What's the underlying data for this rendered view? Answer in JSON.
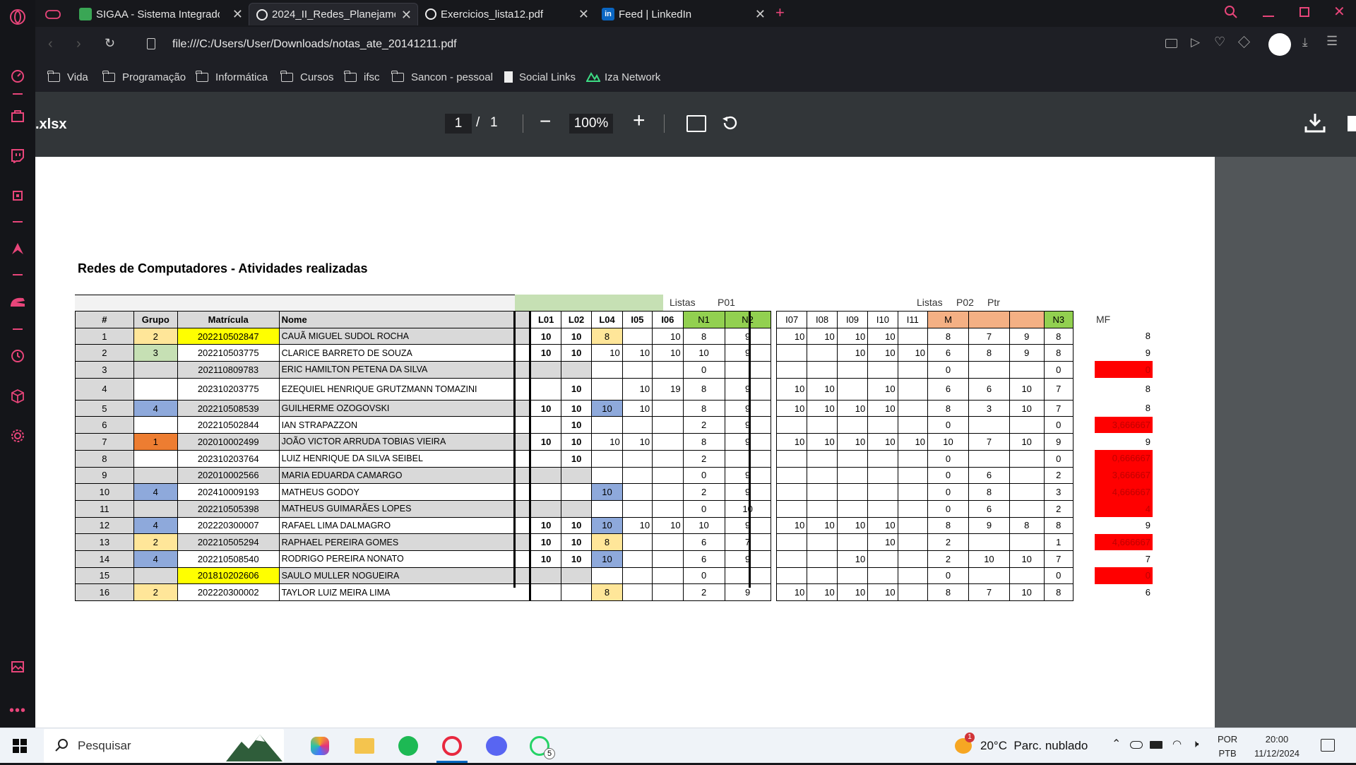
{
  "sidebar": {
    "icons": [
      "opera-logo-icon",
      "speed-dial-icon",
      "bag-icon",
      "twitch-icon",
      "chip-icon",
      "arrow-icon",
      "helmet-icon",
      "history-icon",
      "cube-icon",
      "settings-icon",
      "gallery-icon",
      "more-icon"
    ]
  },
  "tabs": [
    {
      "label": "SIGAA - Sistema Integrado",
      "favicon_color": "#3aa655"
    },
    {
      "label": "2024_II_Redes_Planejament",
      "favicon_color": "#ffffff",
      "active": true
    },
    {
      "label": "Exercicios_lista12.pdf",
      "favicon_color": "#ffffff"
    },
    {
      "label": "Feed | LinkedIn",
      "favicon_color": "#0a66c2"
    }
  ],
  "address": {
    "url": "file:///C:/Users/User/Downloads/notas_ate_20141211.pdf"
  },
  "bookmarks": [
    "Vida",
    "Programação",
    "Informática",
    "Cursos",
    "ifsc",
    "Sancon - pessoal",
    "Social Links",
    "Iza Network"
  ],
  "pdf_toolbar": {
    "filename": ".xlsx",
    "page_current": "1",
    "page_sep": "/",
    "page_total": "1",
    "zoom": "100%",
    "minus": "−",
    "plus": "+"
  },
  "sheet": {
    "title": "Redes de Computadores - Atividades realizadas",
    "group_headers": {
      "listas1": "Listas",
      "p01": "P01",
      "listas2": "Listas",
      "p02": "P02",
      "ptr": "Ptr",
      "mf": "MF"
    },
    "columns": [
      "#",
      "Grupo",
      "Matrícula",
      "Nome",
      "L01",
      "L02",
      "L04",
      "I05",
      "I06",
      "N1",
      "N2",
      "I07",
      "I08",
      "I09",
      "I10",
      "I11",
      "M",
      "",
      "",
      "N3"
    ],
    "rows": [
      {
        "n": "1",
        "grupo": "2",
        "gc": "yel",
        "mat": "202210502847",
        "mc": "bright",
        "nome": "CAUÃ MIGUEL SUDOL ROCHA",
        "l01": "10",
        "l02": "10",
        "l04": "8",
        "l4c": "yel",
        "i05": "",
        "i06": "10",
        "n1": "8",
        "n2": "9",
        "i07": "10",
        "i08": "10",
        "i09": "10",
        "i10": "10",
        "i11": "",
        "m": "8",
        "p02": "7",
        "ptr": "9",
        "n3": "8",
        "mf": "8",
        "mfc": ""
      },
      {
        "n": "2",
        "grupo": "3",
        "gc": "grn",
        "mat": "202210503775",
        "mc": "",
        "nome": "CLARICE BARRETO DE SOUZA",
        "l01": "10",
        "l02": "10",
        "l04": "10",
        "l4c": "",
        "i05": "10",
        "i06": "10",
        "n1": "10",
        "n2": "9",
        "i07": "",
        "i08": "",
        "i09": "10",
        "i10": "10",
        "i11": "10",
        "m": "6",
        "p02": "8",
        "ptr": "9",
        "n3": "8",
        "mf": "9",
        "mfc": ""
      },
      {
        "n": "3",
        "grupo": "",
        "gc": "",
        "mat": "202110809783",
        "mc": "",
        "nome": "ERIC HAMILTON PETENA DA SILVA",
        "l01": "",
        "l02": "",
        "l04": "",
        "l4c": "",
        "i05": "",
        "i06": "",
        "n1": "0",
        "n2": "",
        "i07": "",
        "i08": "",
        "i09": "",
        "i10": "",
        "i11": "",
        "m": "0",
        "p02": "",
        "ptr": "",
        "n3": "0",
        "mf": "0",
        "mfc": "red"
      },
      {
        "n": "4",
        "grupo": "",
        "gc": "",
        "mat": "202310203775",
        "mc": "",
        "nome": "EZEQUIEL HENRIQUE GRUTZMANN TOMAZINI",
        "l01": "",
        "l02": "10",
        "l04": "",
        "l4c": "",
        "i05": "10",
        "i06": "19",
        "n1": "8",
        "n2": "9",
        "i07": "10",
        "i08": "10",
        "i09": "",
        "i10": "10",
        "i11": "",
        "m": "6",
        "p02": "6",
        "ptr": "10",
        "n3": "7",
        "mf": "8",
        "mfc": ""
      },
      {
        "n": "5",
        "grupo": "4",
        "gc": "blu",
        "mat": "202210508539",
        "mc": "",
        "nome": "GUILHERME OZOGOVSKI",
        "l01": "10",
        "l02": "10",
        "l04": "10",
        "l4c": "blu",
        "i05": "10",
        "i06": "",
        "n1": "8",
        "n2": "9",
        "i07": "10",
        "i08": "10",
        "i09": "10",
        "i10": "10",
        "i11": "",
        "m": "8",
        "p02": "3",
        "ptr": "10",
        "n3": "7",
        "mf": "8",
        "mfc": ""
      },
      {
        "n": "6",
        "grupo": "",
        "gc": "",
        "mat": "202210502844",
        "mc": "",
        "nome": "IAN STRAPAZZON",
        "l01": "",
        "l02": "10",
        "l04": "",
        "l4c": "",
        "i05": "",
        "i06": "",
        "n1": "2",
        "n2": "9",
        "i07": "",
        "i08": "",
        "i09": "",
        "i10": "",
        "i11": "",
        "m": "0",
        "p02": "",
        "ptr": "",
        "n3": "0",
        "mf": "3,666667",
        "mfc": "red"
      },
      {
        "n": "7",
        "grupo": "1",
        "gc": "org",
        "mat": "202010002499",
        "mc": "",
        "nome": "JOÃO VICTOR ARRUDA TOBIAS VIEIRA",
        "l01": "10",
        "l02": "10",
        "l04": "10",
        "l4c": "",
        "i05": "10",
        "i06": "",
        "n1": "8",
        "n2": "9",
        "i07": "10",
        "i08": "10",
        "i09": "10",
        "i10": "10",
        "i11": "10",
        "m": "10",
        "p02": "7",
        "ptr": "10",
        "n3": "9",
        "mf": "9",
        "mfc": ""
      },
      {
        "n": "8",
        "grupo": "",
        "gc": "",
        "mat": "202310203764",
        "mc": "",
        "nome": "LUIZ HENRIQUE DA SILVA SEIBEL",
        "l01": "",
        "l02": "10",
        "l04": "",
        "l4c": "",
        "i05": "",
        "i06": "",
        "n1": "2",
        "n2": "",
        "i07": "",
        "i08": "",
        "i09": "",
        "i10": "",
        "i11": "",
        "m": "0",
        "p02": "",
        "ptr": "",
        "n3": "0",
        "mf": "0,666667",
        "mfc": "red"
      },
      {
        "n": "9",
        "grupo": "",
        "gc": "",
        "mat": "202010002566",
        "mc": "",
        "nome": "MARIA EDUARDA CAMARGO",
        "l01": "",
        "l02": "",
        "l04": "",
        "l4c": "",
        "i05": "",
        "i06": "",
        "n1": "0",
        "n2": "9",
        "i07": "",
        "i08": "",
        "i09": "",
        "i10": "",
        "i11": "",
        "m": "0",
        "p02": "6",
        "ptr": "",
        "n3": "2",
        "mf": "3,666667",
        "mfc": "red"
      },
      {
        "n": "10",
        "grupo": "4",
        "gc": "blu",
        "mat": "202410009193",
        "mc": "",
        "nome": "MATHEUS GODOY",
        "l01": "",
        "l02": "",
        "l04": "10",
        "l4c": "blu",
        "i05": "",
        "i06": "",
        "n1": "2",
        "n2": "9",
        "i07": "",
        "i08": "",
        "i09": "",
        "i10": "",
        "i11": "",
        "m": "0",
        "p02": "8",
        "ptr": "",
        "n3": "3",
        "mf": "4,666667",
        "mfc": "red"
      },
      {
        "n": "11",
        "grupo": "",
        "gc": "",
        "mat": "202210505398",
        "mc": "",
        "nome": "MATHEUS GUIMARÃES LOPES",
        "l01": "",
        "l02": "",
        "l04": "",
        "l4c": "",
        "i05": "",
        "i06": "",
        "n1": "0",
        "n2": "10",
        "i07": "",
        "i08": "",
        "i09": "",
        "i10": "",
        "i11": "",
        "m": "0",
        "p02": "6",
        "ptr": "",
        "n3": "2",
        "mf": "4",
        "mfc": "red"
      },
      {
        "n": "12",
        "grupo": "4",
        "gc": "blu",
        "mat": "202220300007",
        "mc": "",
        "nome": "RAFAEL LIMA DALMAGRO",
        "l01": "10",
        "l02": "10",
        "l04": "10",
        "l4c": "blu",
        "i05": "10",
        "i06": "10",
        "n1": "10",
        "n2": "9",
        "i07": "10",
        "i08": "10",
        "i09": "10",
        "i10": "10",
        "i11": "",
        "m": "8",
        "p02": "9",
        "ptr": "8",
        "n3": "8",
        "mf": "9",
        "mfc": ""
      },
      {
        "n": "13",
        "grupo": "2",
        "gc": "yel",
        "mat": "202210505294",
        "mc": "",
        "nome": "RAPHAEL PEREIRA GOMES",
        "l01": "10",
        "l02": "10",
        "l04": "8",
        "l4c": "yel",
        "i05": "",
        "i06": "",
        "n1": "6",
        "n2": "7",
        "i07": "",
        "i08": "",
        "i09": "",
        "i10": "10",
        "i11": "",
        "m": "2",
        "p02": "",
        "ptr": "",
        "n3": "1",
        "mf": "4,666667",
        "mfc": "red"
      },
      {
        "n": "14",
        "grupo": "4",
        "gc": "blu",
        "mat": "202210508540",
        "mc": "",
        "nome": "RODRIGO PEREIRA NONATO",
        "l01": "10",
        "l02": "10",
        "l04": "10",
        "l4c": "blu",
        "i05": "",
        "i06": "",
        "n1": "6",
        "n2": "9",
        "i07": "",
        "i08": "",
        "i09": "10",
        "i10": "",
        "i11": "",
        "m": "2",
        "p02": "10",
        "ptr": "10",
        "n3": "7",
        "mf": "7",
        "mfc": ""
      },
      {
        "n": "15",
        "grupo": "",
        "gc": "",
        "mat": "201810202606",
        "mc": "bright",
        "nome": "SAULO MULLER NOGUEIRA",
        "l01": "",
        "l02": "",
        "l04": "",
        "l4c": "",
        "i05": "",
        "i06": "",
        "n1": "0",
        "n2": "",
        "i07": "",
        "i08": "",
        "i09": "",
        "i10": "",
        "i11": "",
        "m": "0",
        "p02": "",
        "ptr": "",
        "n3": "0",
        "mf": "0",
        "mfc": "red"
      },
      {
        "n": "16",
        "grupo": "2",
        "gc": "yel",
        "mat": "202220300002",
        "mc": "",
        "nome": "TAYLOR LUIZ MEIRA LIMA",
        "l01": "",
        "l02": "",
        "l04": "8",
        "l4c": "yel",
        "i05": "",
        "i06": "",
        "n1": "2",
        "n2": "9",
        "i07": "10",
        "i08": "10",
        "i09": "10",
        "i10": "10",
        "i11": "",
        "m": "8",
        "p02": "7",
        "ptr": "10",
        "n3": "8",
        "mf": "6",
        "mfc": ""
      }
    ]
  },
  "taskbar": {
    "search": "Pesquisar",
    "weather": "20°C  Parc. nublado",
    "lang1": "POR",
    "lang2": "PTB",
    "time": "20:00",
    "date": "11/12/2024",
    "badge_weather": "1",
    "badge_whatsapp": "5"
  }
}
